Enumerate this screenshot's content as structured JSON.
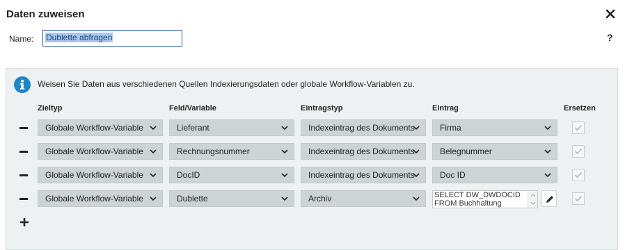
{
  "dialog": {
    "title": "Daten zuweisen",
    "close_icon": "close-icon",
    "help_label": "?"
  },
  "name_field": {
    "label": "Name:",
    "value": "Dublette abfragen"
  },
  "panel": {
    "info_icon": "info-icon",
    "info_text": "Weisen Sie Daten aus verschiedenen Quellen Indexierungsdaten oder globale Workflow-Variablen zu.",
    "headers": {
      "zieltyp": "Zieltyp",
      "feld": "Feld/Variable",
      "eintragstyp": "Eintragstyp",
      "eintrag": "Eintrag",
      "ersetzen": "Ersetzen"
    },
    "rows": [
      {
        "zieltyp": "Globale Workflow-Variable",
        "feld": "Lieferant",
        "eintragstyp": "Indexeintrag des Dokuments",
        "eintrag": "Firma",
        "ersetzen": true
      },
      {
        "zieltyp": "Globale Workflow-Variable",
        "feld": "Rechnungsnummer",
        "eintragstyp": "Indexeintrag des Dokuments",
        "eintrag": "Belegnummer",
        "ersetzen": true
      },
      {
        "zieltyp": "Globale Workflow-Variable",
        "feld": "DocID",
        "eintragstyp": "Indexeintrag des Dokuments",
        "eintrag": "Doc ID",
        "ersetzen": true
      },
      {
        "zieltyp": "Globale Workflow-Variable",
        "feld": "Dublette",
        "eintragstyp": "Archiv",
        "eintrag": "SELECT DW_DWDOCID\nFROM Buchhaltung",
        "ersetzen": true
      }
    ],
    "add_icon": "plus-icon",
    "remove_icon": "minus-icon",
    "edit_icon": "pencil-icon"
  },
  "colors": {
    "accent": "#1c87c9",
    "panel_bg": "#eef1f2",
    "select_bg": "#ced3d6",
    "selection": "#a9c9ee"
  }
}
